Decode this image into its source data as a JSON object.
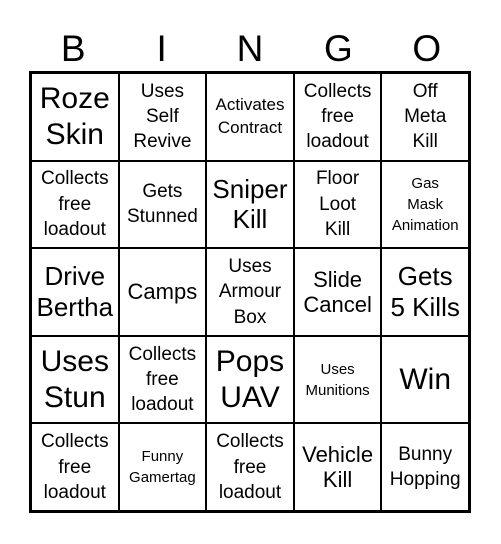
{
  "header": {
    "letters": [
      "B",
      "I",
      "N",
      "G",
      "O"
    ]
  },
  "cells": [
    [
      {
        "text": "Roze\nSkin",
        "size": "s-xl"
      },
      {
        "text": "Uses\nSelf\nRevive",
        "size": "s-sm"
      },
      {
        "text": "Activates\nContract",
        "size": "s-xs"
      },
      {
        "text": "Collects\nfree\nloadout",
        "size": "s-sm"
      },
      {
        "text": "Off\nMeta\nKill",
        "size": "s-sm"
      }
    ],
    [
      {
        "text": "Collects\nfree\nloadout",
        "size": "s-sm"
      },
      {
        "text": "Gets\nStunned",
        "size": "s-sm"
      },
      {
        "text": "Sniper\nKill",
        "size": "s-lg"
      },
      {
        "text": "Floor\nLoot\nKill",
        "size": "s-sm"
      },
      {
        "text": "Gas\nMask\nAnimation",
        "size": "s-xxs"
      }
    ],
    [
      {
        "text": "Drive\nBertha",
        "size": "s-lg"
      },
      {
        "text": "Camps",
        "size": "s-md"
      },
      {
        "text": "Uses\nArmour\nBox",
        "size": "s-sm"
      },
      {
        "text": "Slide\nCancel",
        "size": "s-md"
      },
      {
        "text": "Gets\n5 Kills",
        "size": "s-lg"
      }
    ],
    [
      {
        "text": "Uses\nStun",
        "size": "s-xl"
      },
      {
        "text": "Collects\nfree\nloadout",
        "size": "s-sm"
      },
      {
        "text": "Pops\nUAV",
        "size": "s-xl"
      },
      {
        "text": "Uses\nMunitions",
        "size": "s-xxs"
      },
      {
        "text": "Win",
        "size": "s-xl"
      }
    ],
    [
      {
        "text": "Collects\nfree\nloadout",
        "size": "s-sm"
      },
      {
        "text": "Funny\nGamertag",
        "size": "s-xxs"
      },
      {
        "text": "Collects\nfree\nloadout",
        "size": "s-sm"
      },
      {
        "text": "Vehicle\nKill",
        "size": "s-md"
      },
      {
        "text": "Bunny\nHopping",
        "size": "s-sm"
      }
    ]
  ]
}
